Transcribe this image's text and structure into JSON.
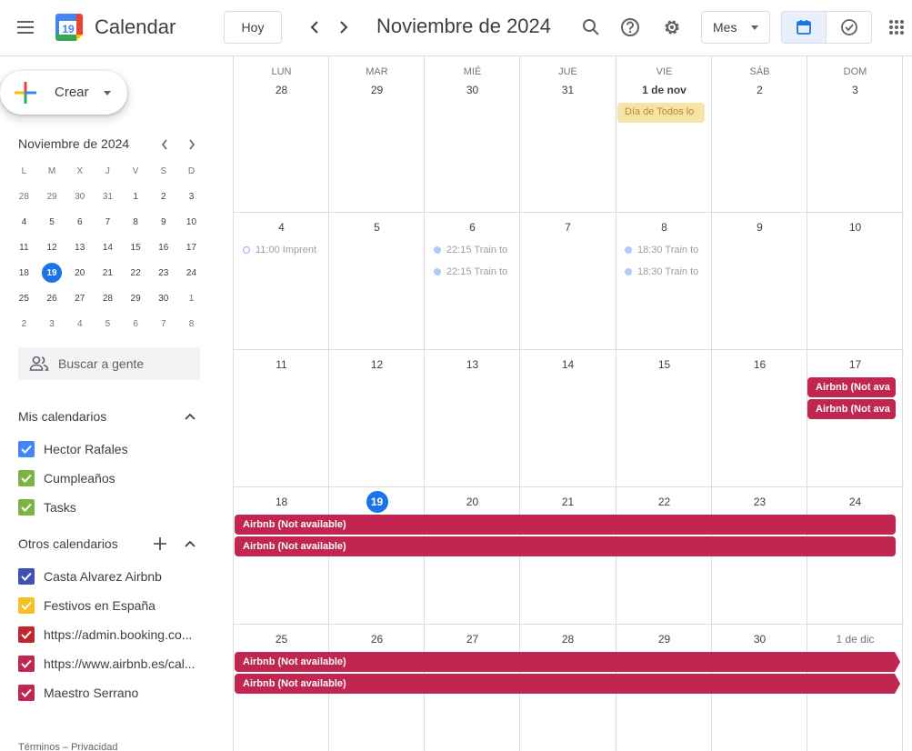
{
  "header": {
    "app_title": "Calendar",
    "logo_day": "19",
    "today_label": "Hoy",
    "period_title": "Noviembre de 2024",
    "view_label": "Mes"
  },
  "sidebar": {
    "create_label": "Crear",
    "mini_title": "Noviembre de 2024",
    "mini_dow": [
      "L",
      "M",
      "X",
      "J",
      "V",
      "S",
      "D"
    ],
    "mini_weeks": [
      [
        "28",
        "29",
        "30",
        "31",
        "1",
        "2",
        "3"
      ],
      [
        "4",
        "5",
        "6",
        "7",
        "8",
        "9",
        "10"
      ],
      [
        "11",
        "12",
        "13",
        "14",
        "15",
        "16",
        "17"
      ],
      [
        "18",
        "19",
        "20",
        "21",
        "22",
        "23",
        "24"
      ],
      [
        "25",
        "26",
        "27",
        "28",
        "29",
        "30",
        "1"
      ],
      [
        "2",
        "3",
        "4",
        "5",
        "6",
        "7",
        "8"
      ]
    ],
    "search_people_placeholder": "Buscar a gente",
    "my_calendars_title": "Mis calendarios",
    "my_calendars": [
      {
        "name": "Hector Rafales",
        "color": "#4285f4"
      },
      {
        "name": "Cumpleaños",
        "color": "#7cb342"
      },
      {
        "name": "Tasks",
        "color": "#7cb342"
      }
    ],
    "other_calendars_title": "Otros calendarios",
    "other_calendars": [
      {
        "name": "Casta Alvarez Airbnb",
        "color": "#3f51b5"
      },
      {
        "name": "Festivos en España",
        "color": "#f6bf26"
      },
      {
        "name": "https://admin.booking.co...",
        "color": "#c0262d"
      },
      {
        "name": "https://www.airbnb.es/cal...",
        "color": "#c0264f"
      },
      {
        "name": "Maestro Serrano",
        "color": "#c0264f"
      }
    ],
    "footer": "Términos – Privacidad"
  },
  "month": {
    "dow_labels": [
      "LUN",
      "MAR",
      "MIÉ",
      "JUE",
      "VIE",
      "SÁB",
      "DOM"
    ],
    "weeks": [
      [
        "28",
        "29",
        "30",
        "31",
        "1 de nov",
        "2",
        "3"
      ],
      [
        "4",
        "5",
        "6",
        "7",
        "8",
        "9",
        "10"
      ],
      [
        "11",
        "12",
        "13",
        "14",
        "15",
        "16",
        "17"
      ],
      [
        "18",
        "19",
        "20",
        "21",
        "22",
        "23",
        "24"
      ],
      [
        "25",
        "26",
        "27",
        "28",
        "29",
        "30",
        "1 de dic"
      ]
    ],
    "holiday_event": "Día de Todos lo",
    "event_imprenta": "11:00 Imprent",
    "event_train": "22:15 Train to",
    "event_train_fri": "18:30 Train to",
    "airbnb_label": "Airbnb (Not available)",
    "airbnb_short": "Airbnb (Not ava"
  }
}
